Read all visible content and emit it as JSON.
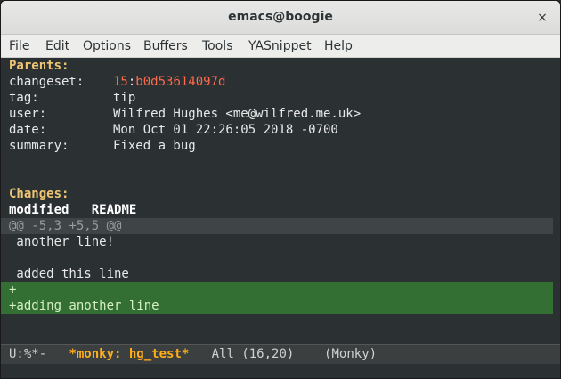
{
  "window": {
    "title": "emacs@boogie",
    "close_glyph": "×"
  },
  "menubar": {
    "items": [
      "File",
      "Edit",
      "Options",
      "Buffers",
      "Tools",
      "YASnippet",
      "Help"
    ]
  },
  "buffer": {
    "parents_heading": "Parents:",
    "changeset_key": "changeset:",
    "changeset_rev": "15",
    "changeset_sep": ":",
    "changeset_hash": "b0d53614097d",
    "tag_key": "tag:",
    "tag_value": "tip",
    "user_key": "user:",
    "user_value": "Wilfred Hughes <me@wilfred.me.uk>",
    "date_key": "date:",
    "date_value": "Mon Oct 01 22:26:05 2018 -0700",
    "summary_key": "summary:",
    "summary_value": "Fixed a bug",
    "changes_heading": "Changes:",
    "file_status": "modified",
    "file_name": "README",
    "hunk_header": "@@ -5,3 +5,5 @@",
    "diff_context_1": " another line!",
    "diff_context_2": "",
    "diff_context_3": " added this line",
    "diff_added_1": "+",
    "diff_added_2": "+adding another line"
  },
  "modeline": {
    "state": "U:%*-",
    "buffer_name": "*monky: hg_test*",
    "position": "All (16,20)",
    "mode": "(Monky)"
  },
  "colors": {
    "background": "#2b3132",
    "heading": "#f0c674",
    "revision": "#ff6a4d",
    "added_bg": "#336f33",
    "hunk_bg": "#3f4546",
    "modeline_buffer": "#ffae1a"
  }
}
